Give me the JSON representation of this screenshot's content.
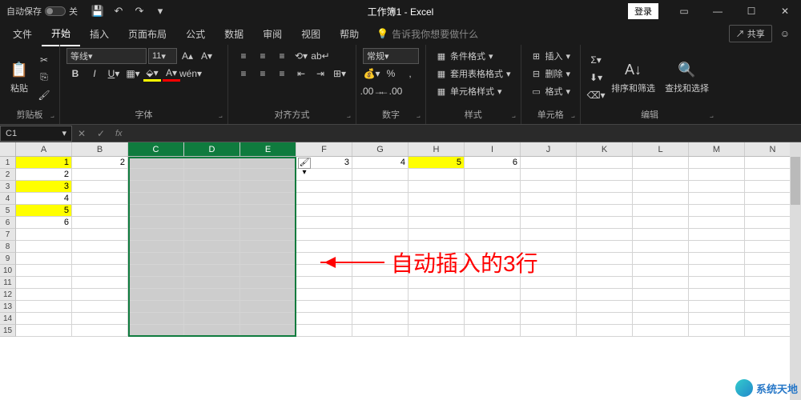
{
  "titlebar": {
    "autosave_label": "自动保存",
    "autosave_state": "关",
    "title": "工作簿1 - Excel",
    "login": "登录"
  },
  "tabs": {
    "items": [
      "文件",
      "开始",
      "插入",
      "页面布局",
      "公式",
      "数据",
      "审阅",
      "视图",
      "帮助"
    ],
    "active_index": 1,
    "tell_me": "告诉我你想要做什么",
    "share": "共享"
  },
  "ribbon": {
    "clipboard": {
      "label": "剪贴板",
      "paste": "粘贴"
    },
    "font": {
      "label": "字体",
      "name": "等线",
      "size": "11"
    },
    "alignment": {
      "label": "对齐方式"
    },
    "number": {
      "label": "数字",
      "format": "常规"
    },
    "styles": {
      "label": "样式",
      "cond_format": "条件格式",
      "table_format": "套用表格格式",
      "cell_styles": "单元格样式"
    },
    "cells": {
      "label": "单元格",
      "insert": "插入",
      "delete": "删除",
      "format": "格式"
    },
    "editing": {
      "label": "编辑",
      "sort_filter": "排序和筛选",
      "find_select": "查找和选择"
    }
  },
  "formula_bar": {
    "name_box": "C1",
    "formula": ""
  },
  "grid": {
    "columns": [
      "A",
      "B",
      "C",
      "D",
      "E",
      "F",
      "G",
      "H",
      "I",
      "J",
      "K",
      "L",
      "M",
      "N"
    ],
    "selected_columns": [
      "C",
      "D",
      "E"
    ],
    "row_count": 15,
    "data": {
      "1": {
        "A": "1",
        "B": "2",
        "F": "3",
        "G": "4",
        "H": "5",
        "I": "6"
      },
      "2": {
        "A": "2"
      },
      "3": {
        "A": "3"
      },
      "4": {
        "A": "4"
      },
      "5": {
        "A": "5"
      },
      "6": {
        "A": "6"
      }
    },
    "yellow_cells": [
      "A1",
      "A3",
      "A5",
      "H1"
    ]
  },
  "annotation": {
    "text": "自动插入的3行"
  },
  "watermark": {
    "text": "系统天地"
  }
}
